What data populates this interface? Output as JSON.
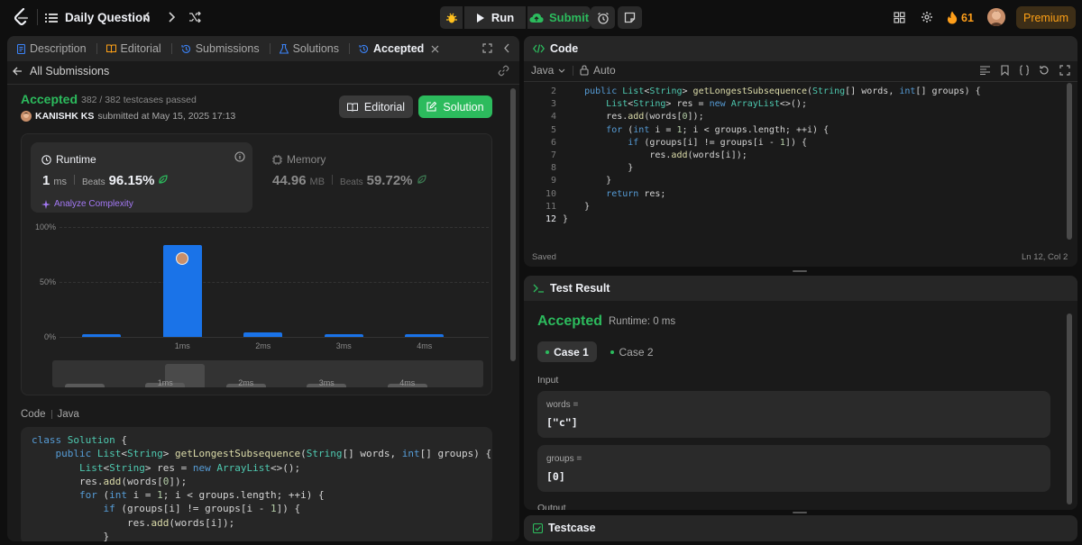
{
  "topbar": {
    "problem_list_label": "Daily Question",
    "run_label": "Run",
    "submit_label": "Submit",
    "streak_count": "61",
    "premium_label": "Premium"
  },
  "left_tabs": {
    "description": "Description",
    "editorial": "Editorial",
    "submissions": "Submissions",
    "solutions": "Solutions",
    "accepted": "Accepted"
  },
  "submission": {
    "back_label": "All Submissions",
    "status": "Accepted",
    "testcases": "382 / 382 testcases passed",
    "user": "KANISHK KS",
    "submitted_at": "submitted at May 15, 2025 17:13",
    "editorial_button": "Editorial",
    "solution_button": "Solution"
  },
  "stats": {
    "runtime_label": "Runtime",
    "runtime_value": "1",
    "runtime_unit": "ms",
    "beats_label": "Beats",
    "runtime_beats": "96.15%",
    "analyze_label": "Analyze Complexity",
    "memory_label": "Memory",
    "memory_value": "44.96",
    "memory_unit": "MB",
    "memory_beats": "59.72%"
  },
  "chart_data": {
    "type": "bar",
    "y_tick_labels": [
      "100%",
      "50%",
      "0%"
    ],
    "categories": [
      "",
      "1ms",
      "2ms",
      "3ms",
      "4ms"
    ],
    "values": [
      2,
      84,
      4.5,
      2,
      2
    ],
    "highlight_category": "1ms",
    "ylim": [
      0,
      100
    ],
    "range_labels": [
      "1ms",
      "2ms",
      "3ms",
      "4ms"
    ]
  },
  "code_section": {
    "label": "Code",
    "lang": "Java",
    "lines": [
      "class Solution {",
      "    public List<String> getLongestSubsequence(String[] words, int[] groups) {",
      "        List<String> res = new ArrayList<>();",
      "        res.add(words[0]);",
      "        for (int i = 1; i < groups.length; ++i) {",
      "            if (groups[i] != groups[i - 1]) {",
      "                res.add(words[i]);",
      "            }"
    ]
  },
  "editor": {
    "title": "Code",
    "language": "Java",
    "autocomplete": "Auto",
    "line_numbers": [
      "2",
      "3",
      "4",
      "5",
      "6",
      "7",
      "8",
      "9",
      "10",
      "11",
      "12"
    ],
    "lines": [
      "    public List<String> getLongestSubsequence(String[] words, int[] groups) {",
      "        List<String> res = new ArrayList<>();",
      "        res.add(words[0]);",
      "        for (int i = 1; i < groups.length; ++i) {",
      "            if (groups[i] != groups[i - 1]) {",
      "                res.add(words[i]);",
      "            }",
      "        }",
      "        return res;",
      "    }",
      "}"
    ],
    "status": "Saved",
    "cursor": "Ln 12, Col 2"
  },
  "test_result": {
    "title": "Test Result",
    "status": "Accepted",
    "runtime": "Runtime: 0 ms",
    "case1": "Case 1",
    "case2": "Case 2",
    "input_label": "Input",
    "var1_name": "words =",
    "var1_value": "[\"c\"]",
    "var2_name": "groups =",
    "var2_value": "[0]",
    "output_label": "Output"
  },
  "testcase": {
    "title": "Testcase"
  },
  "colors": {
    "accent_green": "#2cbb5d",
    "accent_blue": "#1a73e8",
    "premium": "#ffa116",
    "streak": "#ff9f1a"
  }
}
